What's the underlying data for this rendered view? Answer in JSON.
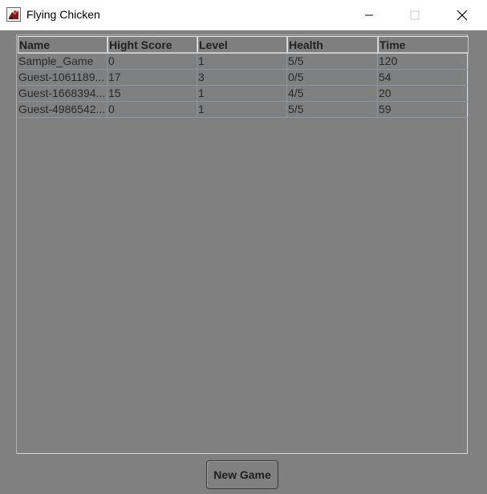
{
  "window": {
    "title": "Flying Chicken",
    "icon": "chicken-app-icon",
    "controls": [
      "minimize-icon",
      "maximize-icon",
      "close-icon"
    ]
  },
  "table": {
    "columns": [
      "Name",
      "Hight Score",
      "Level",
      "Health",
      "Time"
    ],
    "rows": [
      [
        "Sample_Game",
        "0",
        "1",
        "5/5",
        "120"
      ],
      [
        "Guest-1061189...",
        "17",
        "3",
        "0/5",
        "54"
      ],
      [
        "Guest-1668394...",
        "15",
        "1",
        "4/5",
        "20"
      ],
      [
        "Guest-4986542...",
        "0",
        "1",
        "5/5",
        "59"
      ]
    ]
  },
  "actions": {
    "new_game_label": "New Game"
  },
  "colors": {
    "background": "#808080",
    "titlebar": "#ffffff",
    "grid_line": "#8a93a0"
  }
}
